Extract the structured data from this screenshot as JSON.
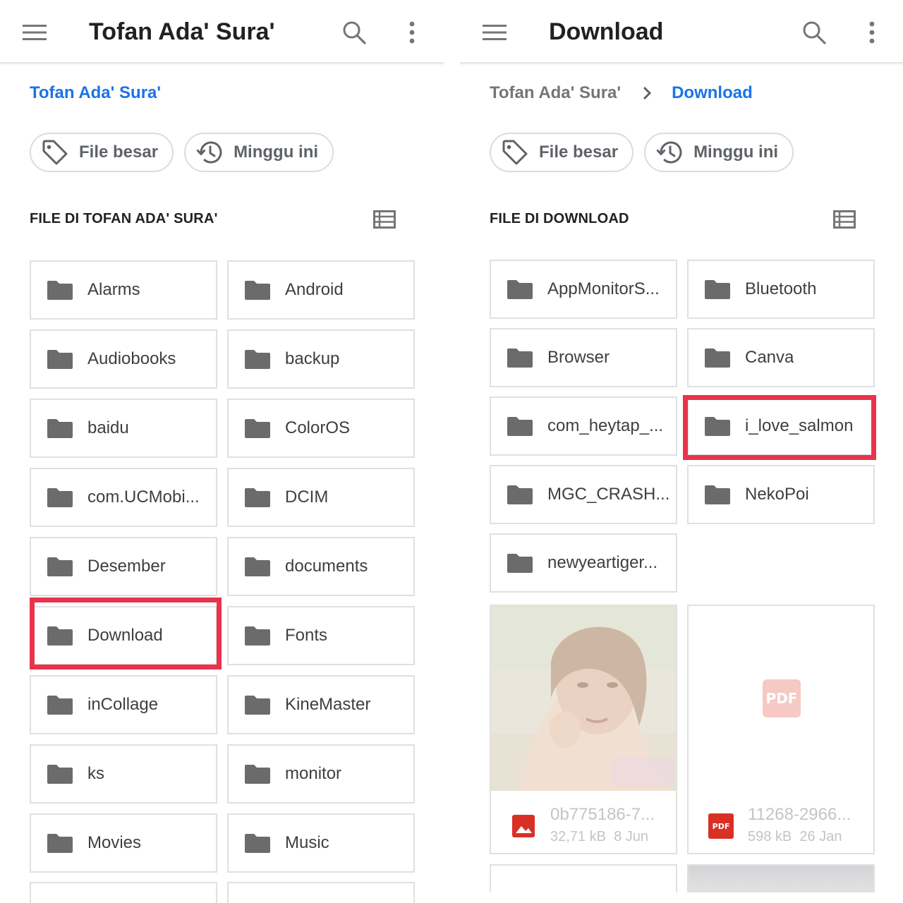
{
  "left": {
    "title": "Tofan Ada' Sura'",
    "breadcrumb": [
      "Tofan Ada' Sura'"
    ],
    "chips": [
      {
        "label": "File besar",
        "icon": "tag-icon"
      },
      {
        "label": "Minggu ini",
        "icon": "history-icon"
      }
    ],
    "section_title": "FILE DI TOFAN ADA' SURA'",
    "folders": [
      "Alarms",
      "Android",
      "Audiobooks",
      "backup",
      "baidu",
      "ColorOS",
      "com.UCMobi...",
      "DCIM",
      "Desember",
      "documents",
      "Download",
      "Fonts",
      "inCollage",
      "KineMaster",
      "ks",
      "monitor",
      "Movies",
      "Music"
    ],
    "highlighted_folder": "Download"
  },
  "right": {
    "title": "Download",
    "breadcrumb": [
      "Tofan Ada' Sura'",
      "Download"
    ],
    "chips": [
      {
        "label": "File besar",
        "icon": "tag-icon"
      },
      {
        "label": "Minggu ini",
        "icon": "history-icon"
      }
    ],
    "section_title": "FILE DI DOWNLOAD",
    "folders": [
      "AppMonitorS...",
      "Bluetooth",
      "Browser",
      "Canva",
      "com_heytap_...",
      "i_love_salmon",
      "MGC_CRASH...",
      "NekoPoi",
      "newyeartiger..."
    ],
    "highlighted_folder": "i_love_salmon",
    "files": [
      {
        "name": "0b775186-7...",
        "size": "32,71 kB",
        "date": "8 Jun",
        "type": "image",
        "icon": "image-file-icon"
      },
      {
        "name": "11268-2966...",
        "size": "598 kB",
        "date": "26 Jan",
        "type": "pdf",
        "icon": "pdf-file-icon",
        "badge": "PDF"
      }
    ]
  },
  "colors": {
    "accent": "#1a73e8",
    "highlight": "#e8334d",
    "folder_icon": "#6b6b6b",
    "pdf_red": "#d93025"
  }
}
